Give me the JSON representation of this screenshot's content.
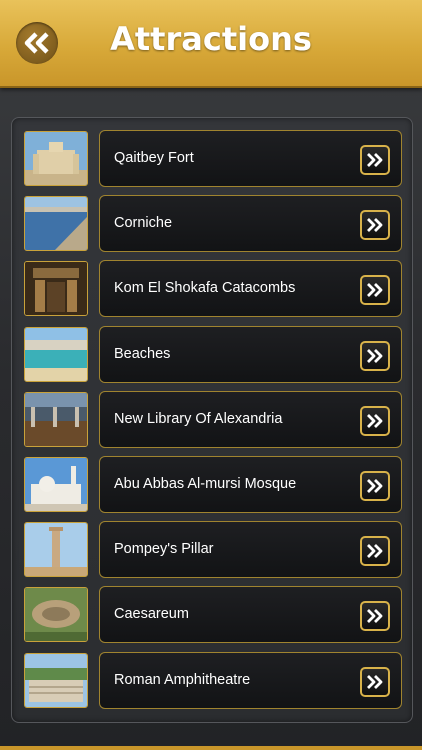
{
  "header": {
    "title": "Attractions",
    "back_icon": "double-chevron-left-icon",
    "accent_color": "#d8a939"
  },
  "attractions": [
    {
      "label": "Qaitbey Fort"
    },
    {
      "label": "Corniche"
    },
    {
      "label": "Kom El Shokafa Catacombs"
    },
    {
      "label": "Beaches"
    },
    {
      "label": "New Library Of Alexandria"
    },
    {
      "label": "Abu Abbas Al-mursi Mosque"
    },
    {
      "label": "Pompey's Pillar"
    },
    {
      "label": "Caesareum"
    },
    {
      "label": "Roman Amphitheatre"
    }
  ],
  "row_action_icon": "double-chevron-right-icon"
}
